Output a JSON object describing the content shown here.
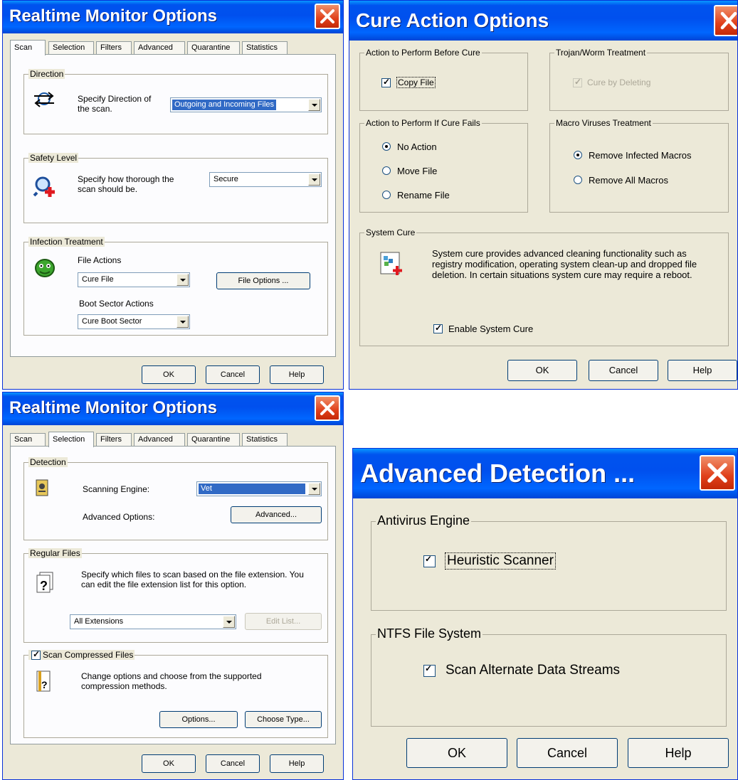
{
  "scan_dialog": {
    "title": "Realtime Monitor Options",
    "tabs": [
      "Scan",
      "Selection",
      "Filters",
      "Advanced",
      "Quarantine",
      "Statistics"
    ],
    "active_tab": "Scan",
    "direction": {
      "legend": "Direction",
      "text_line1": "Specify  Direction of",
      "text_line2": "the scan.",
      "value": "Outgoing and Incoming Files"
    },
    "safety": {
      "legend": "Safety Level",
      "text_line1": "Specify how thorough the",
      "text_line2": "scan should be.",
      "value": "Secure"
    },
    "infection": {
      "legend": "Infection Treatment",
      "file_actions_label": "File Actions",
      "file_actions_value": "Cure File",
      "file_options_button": "File Options ...",
      "boot_label": "Boot Sector Actions",
      "boot_value": "Cure Boot Sector"
    },
    "ok": "OK",
    "cancel": "Cancel",
    "help": "Help"
  },
  "cure_dialog": {
    "title": "Cure Action Options",
    "before_cure": {
      "legend": "Action to Perform Before Cure",
      "copy_file": "Copy File",
      "checked": true
    },
    "trojan": {
      "legend": "Trojan/Worm Treatment",
      "cure_by_deleting": "Cure by Deleting",
      "checked": true
    },
    "if_fails": {
      "legend": "Action to Perform If Cure Fails",
      "options": [
        "No Action",
        "Move File",
        "Rename File"
      ],
      "selected": "No Action"
    },
    "macro": {
      "legend": "Macro Viruses Treatment",
      "options": [
        "Remove Infected Macros",
        "Remove All Macros"
      ],
      "selected": "Remove Infected Macros"
    },
    "system_cure": {
      "legend": "System Cure",
      "desc_line1": "System cure provides advanced cleaning functionality such as",
      "desc_line2": "registry modification, operating system clean-up and dropped file",
      "desc_line3": "deletion. In certain situations system cure may require a reboot.",
      "enable": "Enable System Cure",
      "checked": true
    },
    "ok": "OK",
    "cancel": "Cancel",
    "help": "Help"
  },
  "selection_dialog": {
    "title": "Realtime Monitor Options",
    "tabs": [
      "Scan",
      "Selection",
      "Filters",
      "Advanced",
      "Quarantine",
      "Statistics"
    ],
    "active_tab": "Selection",
    "detection": {
      "legend": "Detection",
      "engine_label": "Scanning Engine:",
      "engine_value": "Vet",
      "advanced_label": "Advanced Options:",
      "advanced_button": "Advanced..."
    },
    "regular_files": {
      "legend": "Regular Files",
      "text_line1": "Specify which files to scan based on the file extension. You",
      "text_line2": "can edit the file extension list for this option.",
      "value": "All Extensions",
      "edit_list_button": "Edit List..."
    },
    "compressed": {
      "legend": "Scan Compressed Files",
      "checked": true,
      "text_line1": "Change options and choose from the supported",
      "text_line2": "compression methods.",
      "options_button": "Options...",
      "choose_type_button": "Choose Type..."
    },
    "ok": "OK",
    "cancel": "Cancel",
    "help": "Help"
  },
  "advanced_dialog": {
    "title": "Advanced Detection ...",
    "engine": {
      "legend": "Antivirus Engine",
      "heuristic": "Heuristic Scanner",
      "checked": true
    },
    "ntfs": {
      "legend": "NTFS File System",
      "ads": "Scan Alternate Data Streams",
      "checked": true
    },
    "ok": "OK",
    "cancel": "Cancel",
    "help": "Help"
  },
  "colors": {
    "title_blue": "#0054e3",
    "face": "#ece9d8",
    "close_red": "#e0401b",
    "selection": "#316ac5"
  }
}
